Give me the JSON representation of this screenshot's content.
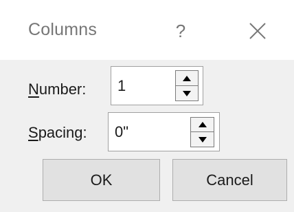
{
  "dialog": {
    "title": "Columns",
    "help_label": "?",
    "close_icon": "close-icon"
  },
  "number": {
    "label_mnemonic": "N",
    "label_rest": "umber:",
    "value": "1",
    "up_icon": "triangle-up-icon",
    "down_icon": "triangle-down-icon"
  },
  "spacing": {
    "label_mnemonic": "S",
    "label_rest": "pacing:",
    "value": "0\"",
    "up_icon": "triangle-up-icon",
    "down_icon": "triangle-down-icon"
  },
  "buttons": {
    "ok_label": "OK",
    "cancel_label": "Cancel"
  }
}
